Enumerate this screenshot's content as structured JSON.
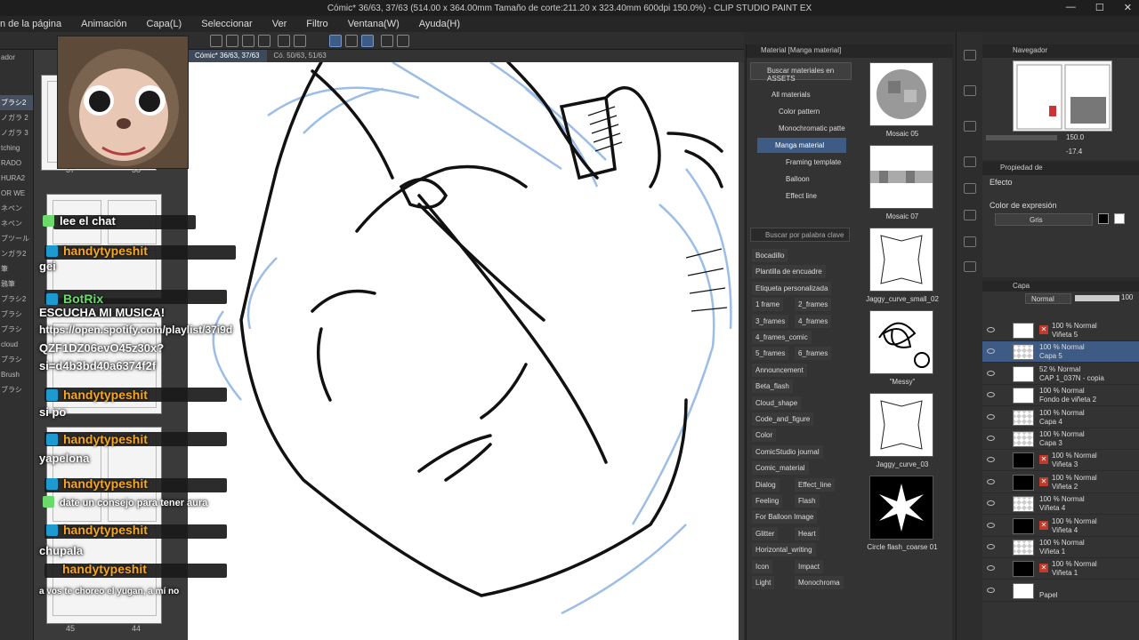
{
  "window": {
    "title": "Cómic* 36/63, 37/63 (514.00 x 364.00mm Tamaño de corte:211.20 x 323.40mm 600dpi 150.0%) - CLIP STUDIO PAINT EX",
    "controls": [
      "—",
      "☐",
      "✕"
    ]
  },
  "menu": [
    "n de la página",
    "Animación",
    "Capa(L)",
    "Seleccionar",
    "Ver",
    "Filtro",
    "Ventana(W)",
    "Ayuda(H)"
  ],
  "left_strip": {
    "items": [
      "ador",
      "",
      "",
      "ブラシ2",
      "ノガラ 2",
      "ノガラ 3",
      "tching",
      "RADO",
      "HURA2",
      "OR WE",
      "ネペン",
      "ネペン",
      "ブツール",
      "ンガラ2",
      "筆",
      "鴉筆",
      "ブラシ2",
      "ブラシ",
      "ブラシ",
      "cloud",
      "ブラシ",
      "Brush",
      "ブラシ"
    ]
  },
  "pages": {
    "numbers_top": [
      "37",
      "38"
    ],
    "numbers_bottom": [
      "45",
      "44"
    ]
  },
  "canvas_tabs": [
    "Cómic* 36/63, 37/63",
    "Có. 50/63, 51/63"
  ],
  "chat": [
    {
      "user": "",
      "msg": "lee el chat"
    },
    {
      "user": "handytypeshit",
      "msg": "gei"
    },
    {
      "user": "BotRix",
      "msg": "ESCUCHA MI MUSICA!"
    },
    {
      "user": "",
      "msg": "https://open.spotify.com/playlist/37i9d"
    },
    {
      "user": "",
      "msg": "QZF1DZ06evO45z30x?"
    },
    {
      "user": "",
      "msg": "si=d4b3bd40a6374f2f"
    },
    {
      "user": "handytypeshit",
      "msg": "si po"
    },
    {
      "user": "handytypeshit",
      "msg": "yapelona"
    },
    {
      "user": "handytypeshit",
      "msg": "date un consejo para tener aura"
    },
    {
      "user": "handytypeshit",
      "msg": "chupala"
    },
    {
      "user": "handytypeshit",
      "msg": "a vos te choreo el yugan, a mí no"
    }
  ],
  "material": {
    "header": "Material [Manga material]",
    "assets_button": "Buscar materiales en ASSETS",
    "tree": [
      "All materials",
      "Color pattern",
      "Monochromatic patte",
      "Manga material",
      "Framing template",
      "Balloon",
      "Effect line"
    ],
    "search_placeholder": "Buscar por palabra clave",
    "tags": [
      [
        "Bocadillo"
      ],
      [
        "Plantilla de encuadre"
      ],
      [
        "Etiqueta personalizada"
      ],
      [
        "1 frame",
        "2_frames"
      ],
      [
        "3_frames",
        "4_frames"
      ],
      [
        "4_frames_comic"
      ],
      [
        "5_frames",
        "6_frames"
      ],
      [
        "Announcement"
      ],
      [
        "Beta_flash"
      ],
      [
        "Cloud_shape"
      ],
      [
        "Code_and_figure"
      ],
      [
        "Color"
      ],
      [
        "ComicStudio journal"
      ],
      [
        "Comic_material"
      ],
      [
        "Dialog",
        "Effect_line"
      ],
      [
        "Feeling",
        "Flash"
      ],
      [
        "For Balloon Image"
      ],
      [
        "Glitter",
        "Heart"
      ],
      [
        "Horizontal_writing"
      ],
      [
        "Icon",
        "Impact"
      ],
      [
        "Light",
        "Monochroma"
      ]
    ],
    "thumbs": [
      "Mosaic 05",
      "Mosaic 07",
      "Jaggy_curve_small_02",
      "\"Messy\"",
      "Jaggy_curve_03",
      "Circle flash_coarse 01"
    ]
  },
  "navigator": {
    "header": "Navegador",
    "zoom": "150.0",
    "angle": "-17.4"
  },
  "properties": {
    "header": "Propiedad de",
    "effect_label": "Efecto",
    "expr_label": "Color de expresión",
    "expr_value": "Gris"
  },
  "layers": {
    "header": "Capa",
    "blend": "Normal",
    "opacity": "100",
    "rows": [
      {
        "l1": "100 % Normal",
        "l2": "Viñeta 5",
        "thumb": "white",
        "mask": true
      },
      {
        "l1": "100 % Normal",
        "l2": "Capa 5",
        "thumb": "check",
        "sel": true
      },
      {
        "l1": "52 % Normal",
        "l2": "CAP 1_037N - copia",
        "thumb": "white"
      },
      {
        "l1": "100 % Normal",
        "l2": "Fondo de viñeta 2",
        "thumb": "white"
      },
      {
        "l1": "100 % Normal",
        "l2": "Capa 4",
        "thumb": "check"
      },
      {
        "l1": "100 % Normal",
        "l2": "Capa 3",
        "thumb": "check"
      },
      {
        "l1": "100 % Normal",
        "l2": "Viñeta 3",
        "thumb": "black",
        "mask": true
      },
      {
        "l1": "100 % Normal",
        "l2": "Viñeta 2",
        "thumb": "black",
        "mask": true
      },
      {
        "l1": "100 % Normal",
        "l2": "Viñeta 4",
        "thumb": "check"
      },
      {
        "l1": "100 % Normal",
        "l2": "Viñeta 4",
        "thumb": "black",
        "mask": true
      },
      {
        "l1": "100 % Normal",
        "l2": "Viñeta 1",
        "thumb": "check"
      },
      {
        "l1": "100 % Normal",
        "l2": "Viñeta 1",
        "thumb": "black",
        "mask": true
      },
      {
        "l1": "",
        "l2": "Papel",
        "thumb": "white"
      }
    ]
  }
}
